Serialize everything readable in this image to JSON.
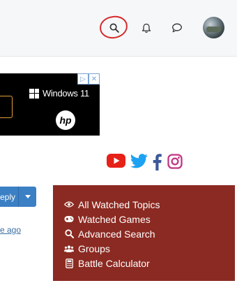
{
  "header": {
    "icons": [
      "search-icon",
      "bell-icon",
      "chat-icon",
      "avatar"
    ]
  },
  "ad": {
    "brand": "Windows 11",
    "logo_text": "hp",
    "badge_icons": [
      "ad-choices-icon",
      "close-icon"
    ]
  },
  "social": [
    "youtube-icon",
    "twitter-icon",
    "facebook-icon",
    "instagram-icon"
  ],
  "reply": {
    "label": "eply"
  },
  "post": {
    "time_ago": "e ago"
  },
  "panel": {
    "items": [
      {
        "icon": "eye-icon",
        "label": "All Watched Topics"
      },
      {
        "icon": "gamepad-icon",
        "label": "Watched Games"
      },
      {
        "icon": "search-icon",
        "label": "Advanced Search"
      },
      {
        "icon": "users-icon",
        "label": "Groups"
      },
      {
        "icon": "calculator-icon",
        "label": "Battle Calculator"
      }
    ]
  },
  "colors": {
    "panel_bg": "#8b2a22",
    "reply_bg": "#3b7fc4",
    "youtube": "#e62117",
    "twitter": "#1da1f2",
    "facebook": "#3b5998",
    "instagram": "#c13584",
    "annotation": "#d62a2a"
  }
}
